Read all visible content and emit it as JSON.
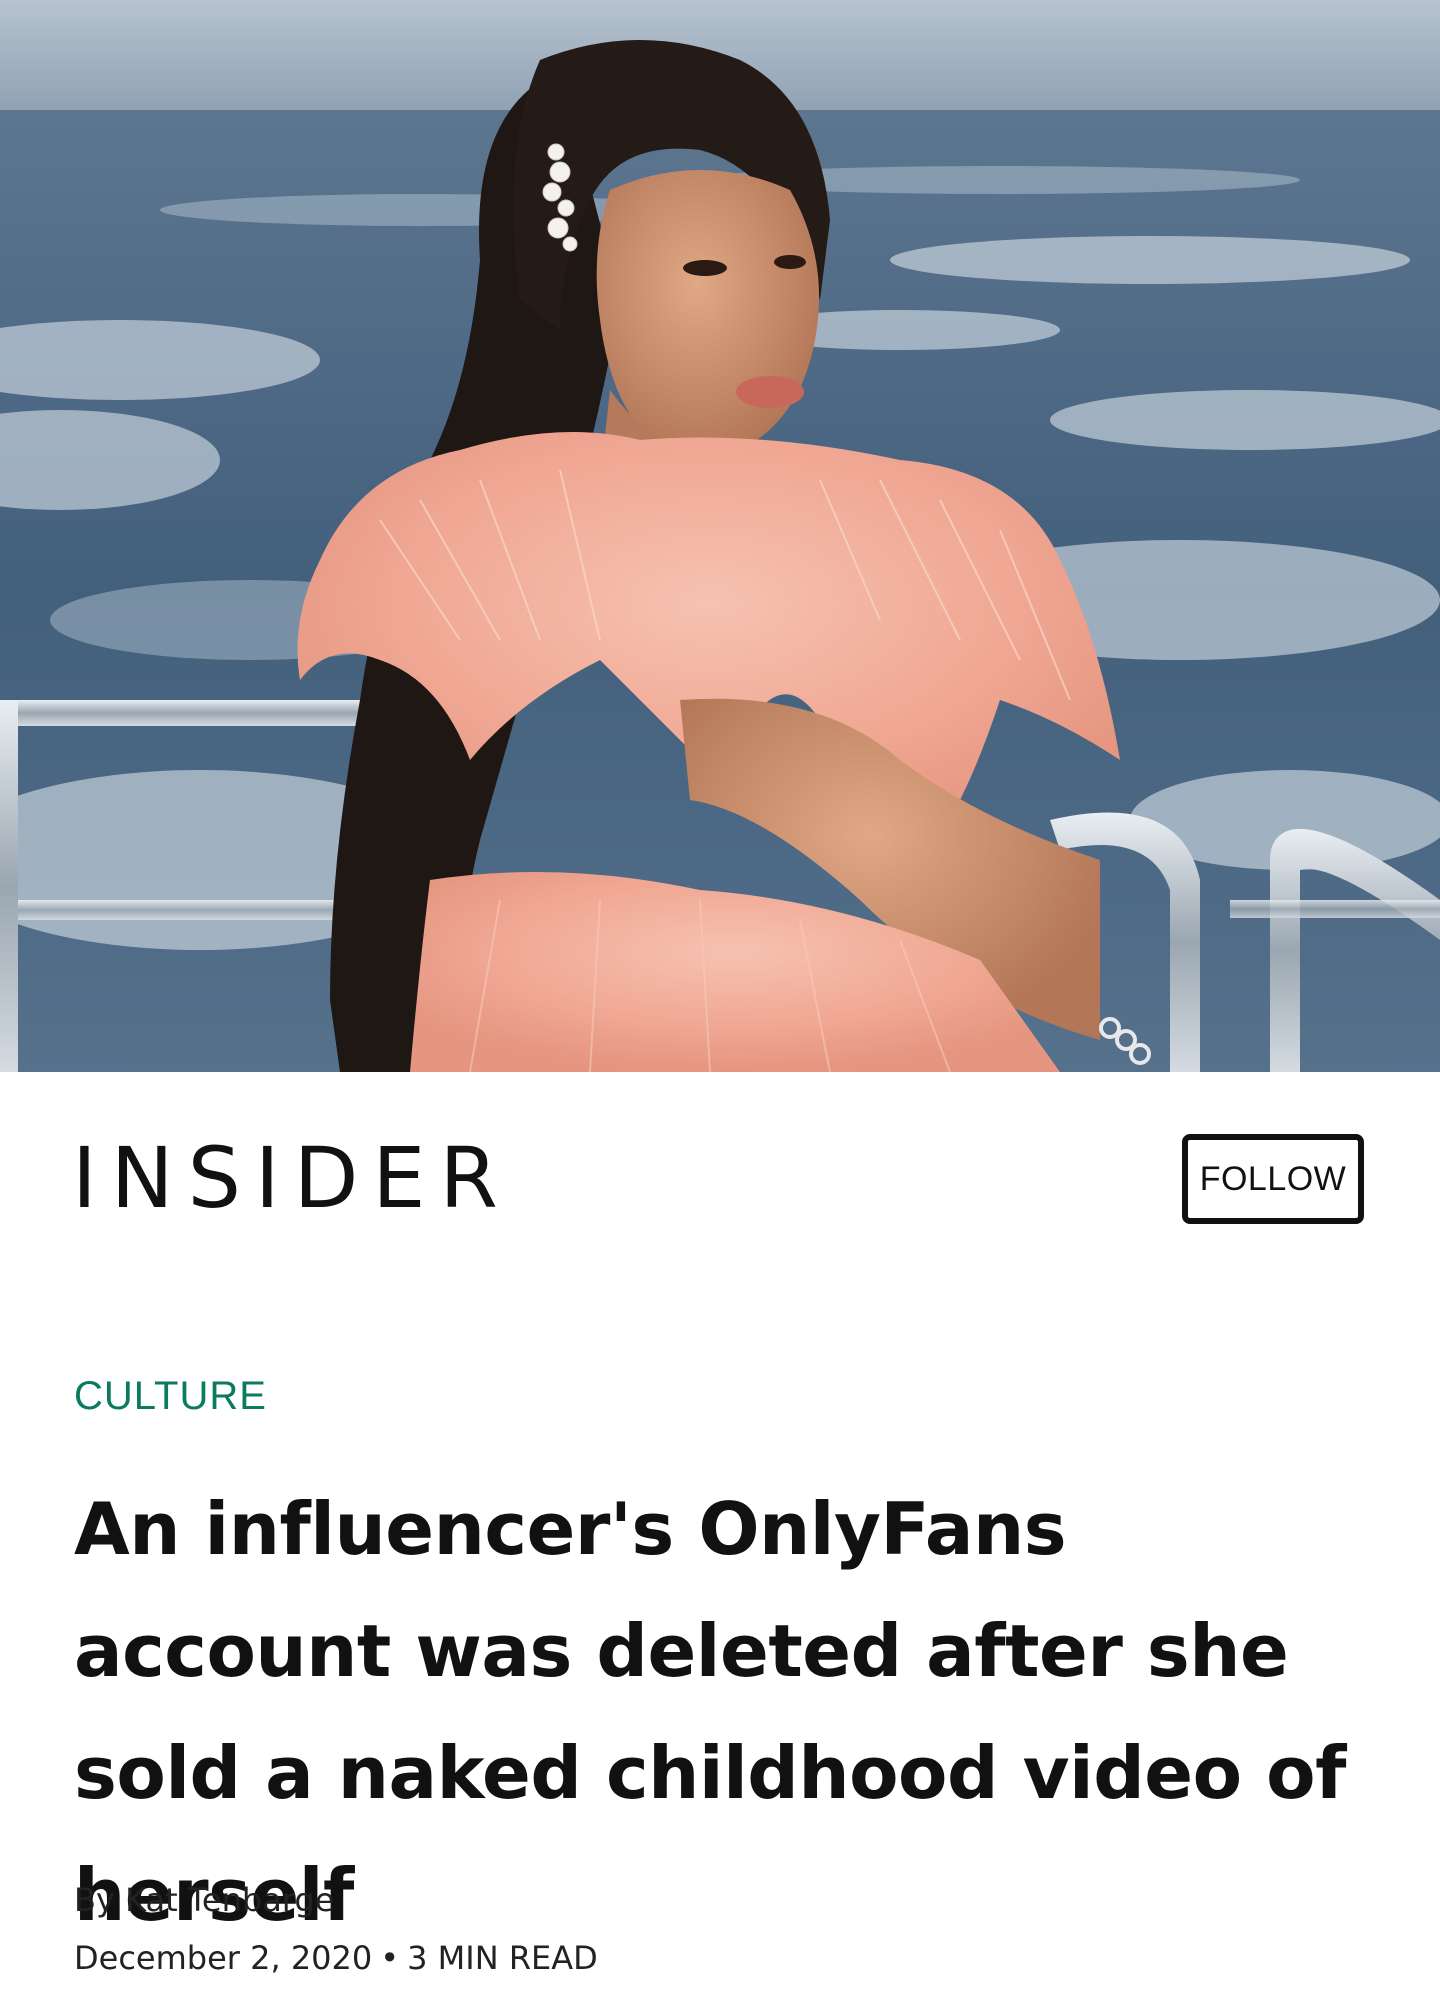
{
  "hero": {
    "image_icon": "photo-woman-pink-tulle-dress-on-boat"
  },
  "brand": {
    "logo": "INSIDER",
    "follow_label": "FOLLOW"
  },
  "article": {
    "category": "CULTURE",
    "headline": "An influencer's OnlyFans account was deleted after she sold a naked childhood video of herself",
    "byline": "By Kat Tenbarge",
    "date": "December 2, 2020",
    "separator": "•",
    "read_time": "3 MIN READ"
  },
  "colors": {
    "category": "#0b7a5e",
    "text": "#111111",
    "background": "#ffffff"
  }
}
